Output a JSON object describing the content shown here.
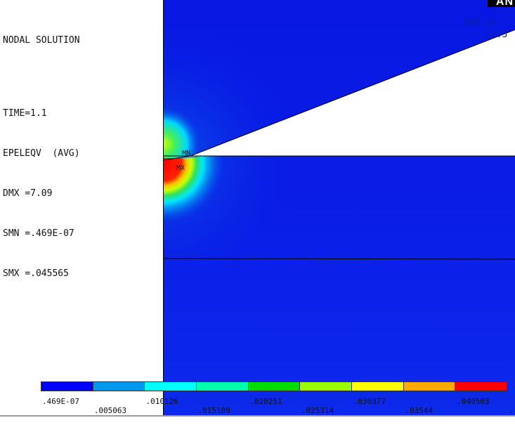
{
  "info": {
    "title": "NODAL SOLUTION",
    "time": "TIME=1.1",
    "item": "EPELEQV  (AVG)",
    "dmx": "DMX =7.09",
    "smn": "SMN =.469E-07",
    "smx": "SMX =.045565"
  },
  "plot": {
    "date_line1": "JUN 10",
    "date_line2": "13:3",
    "logo_text": "AN",
    "min_marker": "MN",
    "max_marker": "MX"
  },
  "legend": {
    "colors": [
      "#0000ff",
      "#0099ee",
      "#00ffff",
      "#00ffaa",
      "#00dd00",
      "#99ff00",
      "#ffff00",
      "#ffaa00",
      "#ff0000"
    ],
    "upper_ticks": [
      ".469E-07",
      ".010126",
      ".020251",
      ".030377",
      ".040503"
    ],
    "lower_ticks": [
      ".005063",
      ".015189",
      ".025314",
      ".03544",
      "."
    ]
  }
}
